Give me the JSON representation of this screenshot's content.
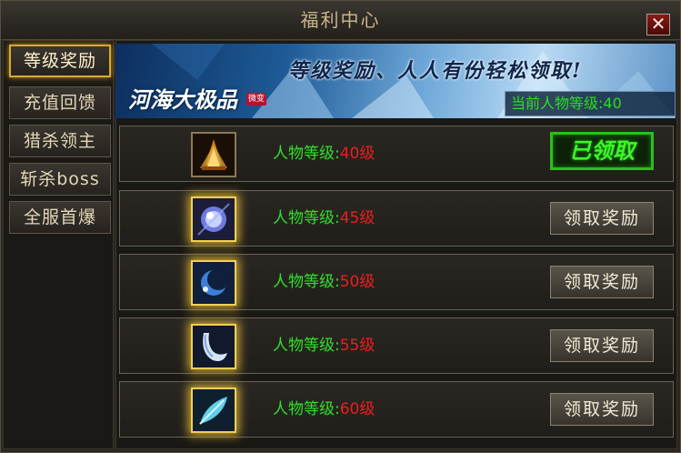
{
  "window": {
    "title": "福利中心",
    "close_label": "✕"
  },
  "sidebar": {
    "tabs": [
      {
        "label": "等级奖励",
        "active": true
      },
      {
        "label": "充值回馈",
        "active": false
      },
      {
        "label": "猎杀领主",
        "active": false
      },
      {
        "label": "斩杀boss",
        "active": false
      },
      {
        "label": "全服首爆",
        "active": false
      }
    ]
  },
  "banner": {
    "logo": "河海大极品",
    "badge": "微变",
    "slogan": "等级奖励、人人有份轻松领取!",
    "current_level": "当前人物等级:40"
  },
  "rewards": [
    {
      "label": "人物等级:",
      "value": "40级",
      "action": "已领取",
      "claimed": true,
      "icon": "flame-crown-icon"
    },
    {
      "label": "人物等级:",
      "value": "45级",
      "action": "领取奖励",
      "claimed": false,
      "icon": "crystal-orb-icon"
    },
    {
      "label": "人物等级:",
      "value": "50级",
      "action": "领取奖励",
      "claimed": false,
      "icon": "crescent-orb-icon"
    },
    {
      "label": "人物等级:",
      "value": "55级",
      "action": "领取奖励",
      "claimed": false,
      "icon": "horn-icon"
    },
    {
      "label": "人物等级:",
      "value": "60级",
      "action": "领取奖励",
      "claimed": false,
      "icon": "feather-icon"
    }
  ],
  "colors": {
    "accent": "#d9a838",
    "req_label": "#2fe02a",
    "req_value": "#ee1d1d",
    "claimed": "#3df52a"
  }
}
